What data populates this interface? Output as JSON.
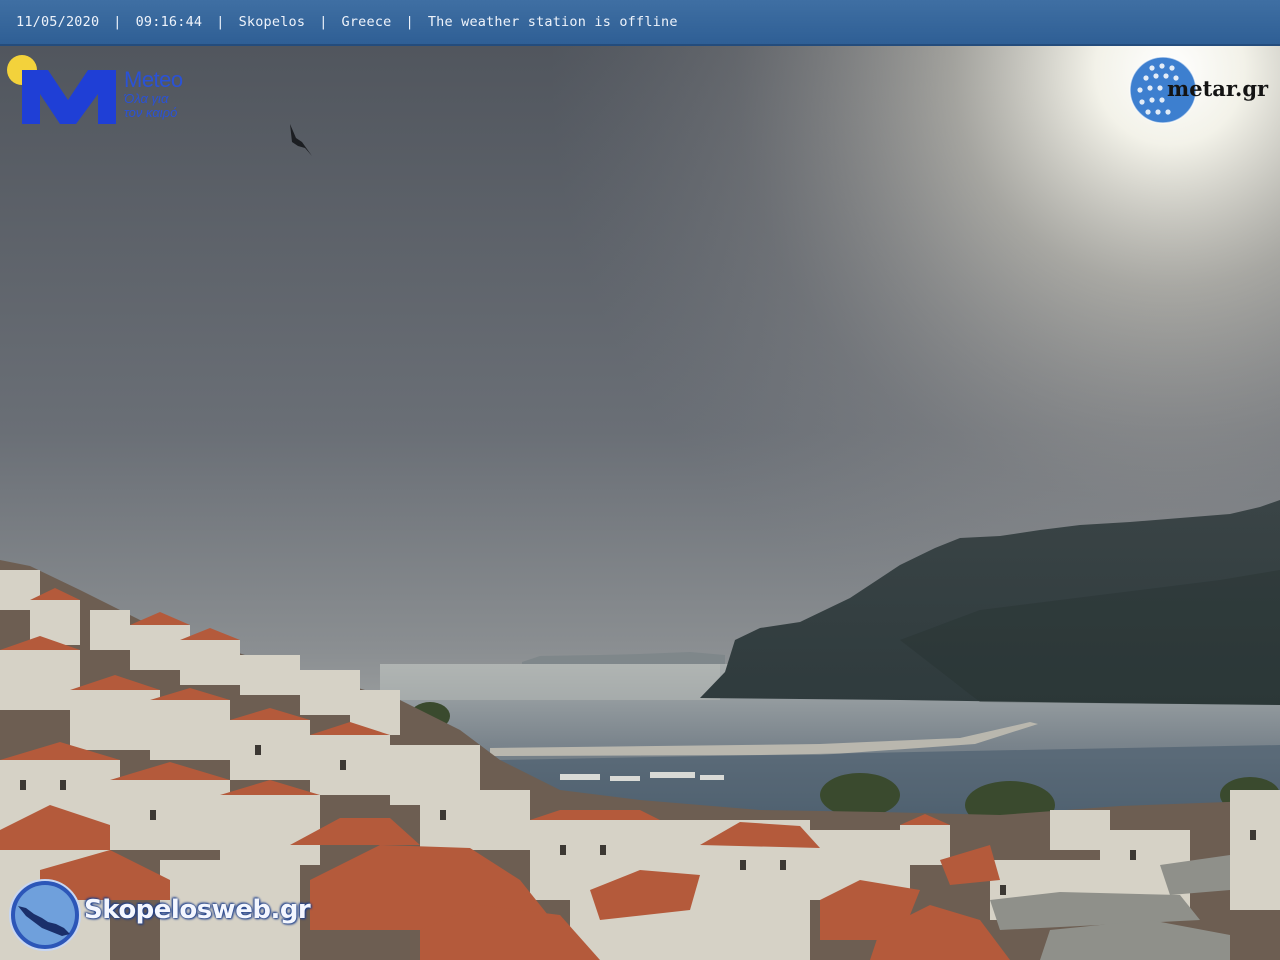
{
  "status_bar": {
    "date": "11/05/2020",
    "time": "09:16:44",
    "location": "Skopelos",
    "country": "Greece",
    "station_status": "The weather station is offline",
    "separator": "|"
  },
  "overlays": {
    "meteo": {
      "name": "Meteo",
      "tagline_line1": "Όλα για",
      "tagline_line2": "τον καιρό",
      "icon": "sun-icon"
    },
    "metar": {
      "name": "metar.gr",
      "icon": "globe-icon"
    },
    "skopelosweb": {
      "name": "Skopelosweb.gr",
      "icon": "island-map-icon"
    }
  },
  "colors": {
    "status_bar": "#3466a0",
    "meteo_blue": "#1f3fd6",
    "meteo_sun": "#f3d23b",
    "sky": "#5b616a",
    "sea": "#7e8891",
    "roofs": "#b45a3b"
  }
}
